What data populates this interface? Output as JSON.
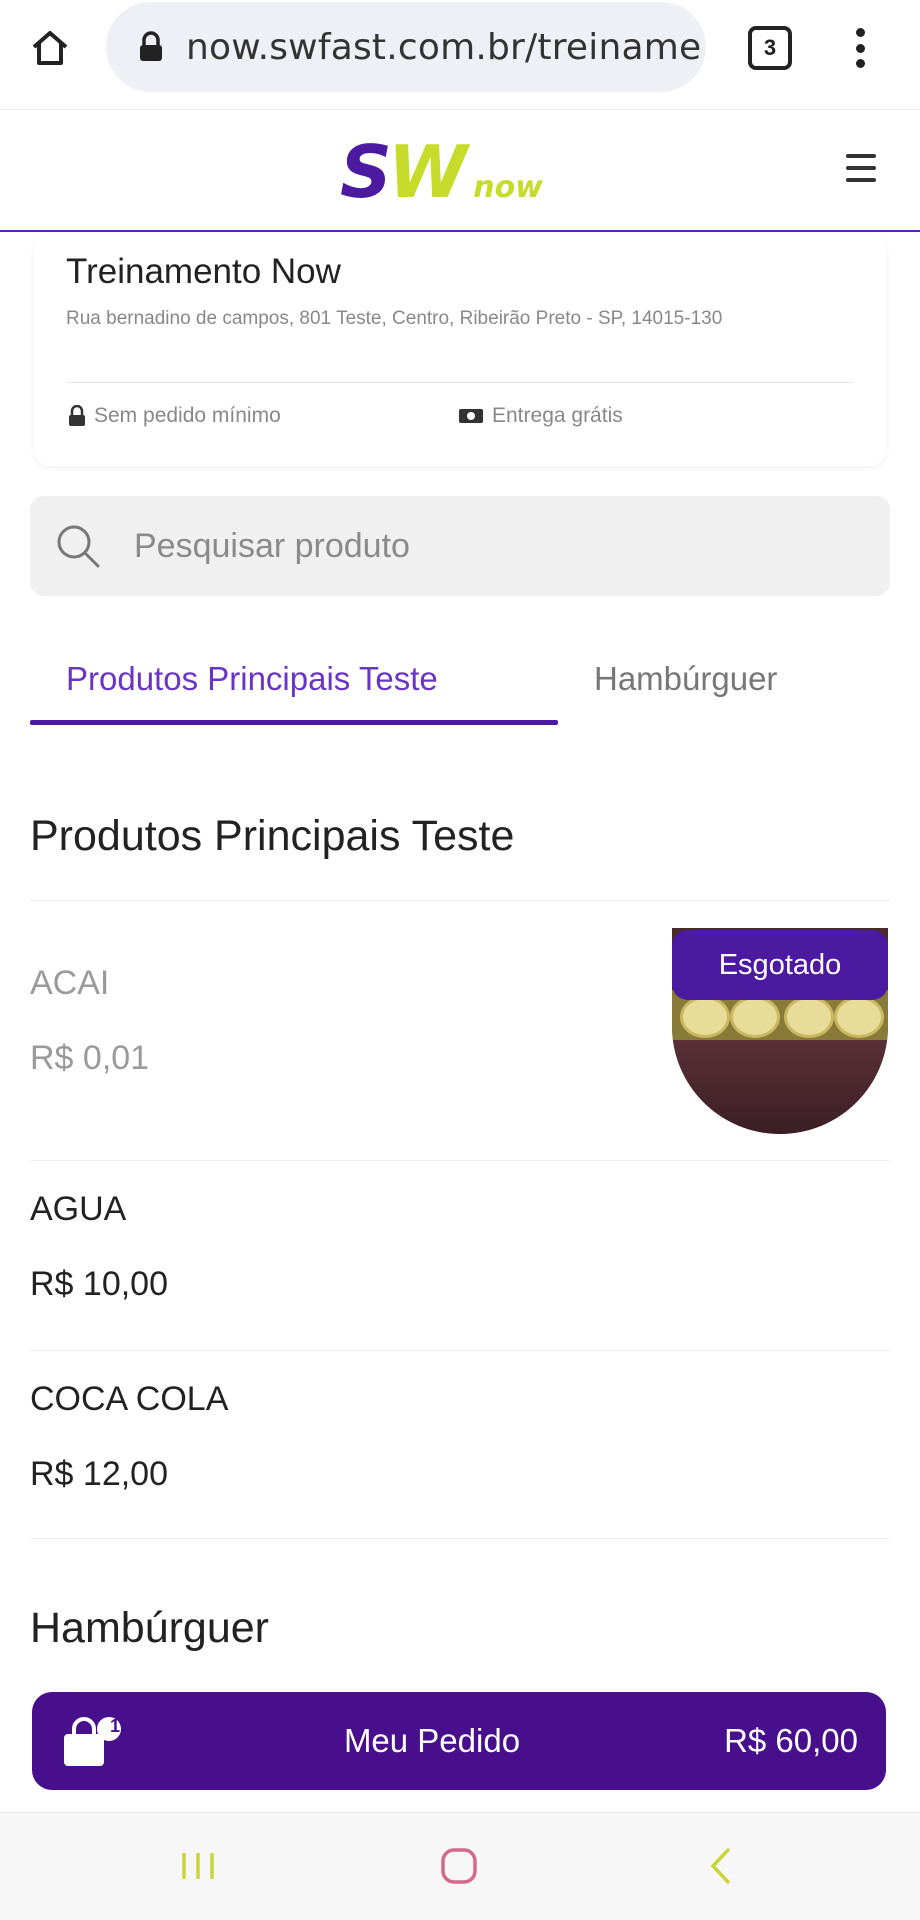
{
  "browser": {
    "url": "now.swfast.com.br/treiname",
    "tab_count": "3"
  },
  "header": {
    "logo_sw_s": "S",
    "logo_sw_w": "W",
    "logo_now": "now"
  },
  "store": {
    "name": "Treinamento Now",
    "address": "Rua bernadino de campos, 801 Teste, Centro, Ribeirão Preto - SP, 14015-130",
    "min_order": "Sem pedido mínimo",
    "delivery": "Entrega grátis"
  },
  "search": {
    "placeholder": "Pesquisar produto"
  },
  "category_tabs": [
    {
      "label": "Produtos Principais Teste",
      "active": true
    },
    {
      "label": "Hambúrguer",
      "active": false
    }
  ],
  "sections": [
    {
      "title": "Produtos Principais Teste",
      "products": [
        {
          "name": "ACAI",
          "price": "R$ 0,01",
          "badge": "Esgotado",
          "available": false
        },
        {
          "name": "AGUA",
          "price": "R$ 10,00",
          "available": true
        },
        {
          "name": "COCA COLA",
          "price": "R$ 12,00",
          "available": true
        }
      ]
    },
    {
      "title": "Hambúrguer",
      "products": []
    }
  ],
  "order_bar": {
    "label": "Meu Pedido",
    "total": "R$ 60,00",
    "item_count": "1"
  },
  "colors": {
    "brand_purple": "#470f8c",
    "brand_lime": "#c6db2a",
    "tab_active_text": "#6a35c5"
  },
  "icons": [
    "home-icon",
    "lock-icon",
    "tabs-icon",
    "overflow-menu-icon",
    "hamburger-menu-icon",
    "padlock-icon",
    "money-icon",
    "search-icon",
    "shopping-bag-icon",
    "recent-apps-icon",
    "home-nav-icon",
    "back-icon"
  ]
}
